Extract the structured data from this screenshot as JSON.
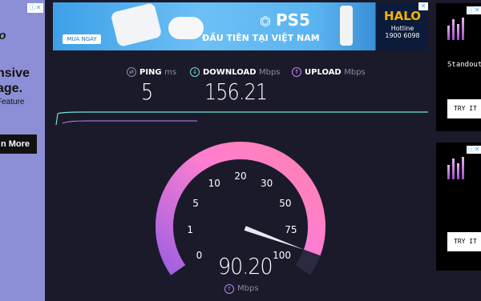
{
  "left_ad": {
    "chip": "ⓘ✕",
    "brand": "eo",
    "headline_1": "nsive",
    "headline_2": "age.",
    "feature": "Feature",
    "cta": "n More"
  },
  "banner": {
    "brand": "PS5",
    "tagline": "ĐẦU TIÊN TẠI VIỆT NAM",
    "buy": "MUA NGAY",
    "halo": "HALO",
    "hotline_label": "Hotline",
    "hotline": "1900 6098",
    "chip": "✕"
  },
  "right_ads": [
    {
      "text": "Standout",
      "cta": "TRY IT",
      "chip": "ⓘ✕"
    },
    {
      "text": "",
      "cta": "TRY IT",
      "chip": "ⓘ✕"
    }
  ],
  "stats": {
    "ping": {
      "label": "PING",
      "unit": "ms",
      "value": "5"
    },
    "download": {
      "label": "DOWNLOAD",
      "unit": "Mbps",
      "value": "156.21"
    },
    "upload": {
      "label": "UPLOAD",
      "unit": "Mbps",
      "value": ""
    }
  },
  "gauge": {
    "ticks": [
      "0",
      "1",
      "5",
      "10",
      "20",
      "30",
      "50",
      "75",
      "100"
    ],
    "speed": "90.20",
    "unit": "Mbps",
    "needle_fraction": 0.94,
    "colors": {
      "track_start": "#c060f0",
      "track_end": "#ff80c0",
      "bg": "#2a2a40"
    }
  }
}
